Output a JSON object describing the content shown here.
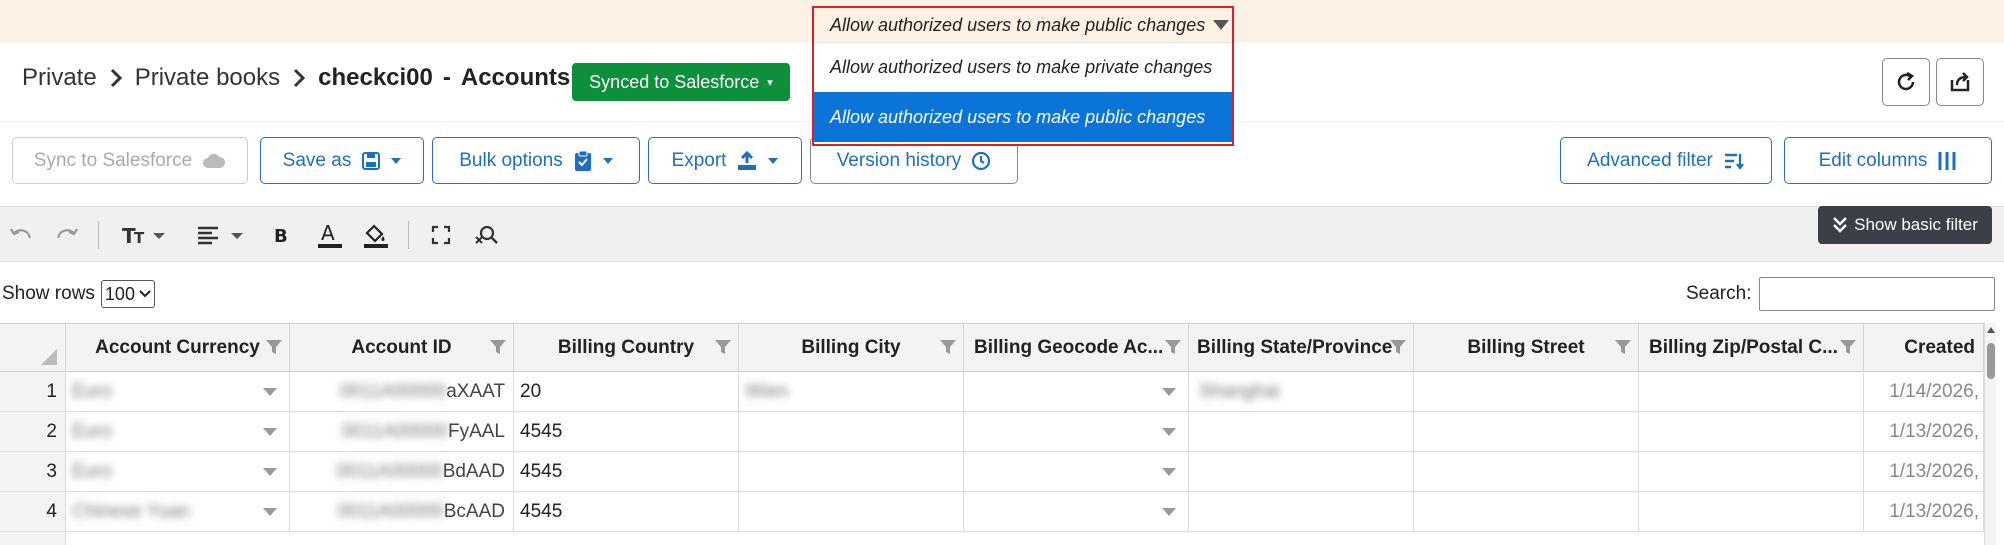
{
  "permission_dropdown": {
    "selected": "Allow authorized users to make public changes",
    "options": [
      "Allow authorized users to make private changes",
      "Allow authorized users to make public changes"
    ],
    "active_index": 1
  },
  "breadcrumb": {
    "root": "Private",
    "folder": "Private books",
    "book": "checkci00",
    "sheet": "Accounts"
  },
  "synced_button": {
    "label": "Synced to Salesforce",
    "color": "#0d8f3c"
  },
  "toolbar": {
    "sync": "Sync to Salesforce",
    "save_as": "Save as",
    "bulk_options": "Bulk options",
    "export": "Export",
    "version_history": "Version history",
    "advanced_filter": "Advanced filter",
    "edit_columns": "Edit columns"
  },
  "show_basic_filter": "Show basic filter",
  "rows_control": {
    "label": "Show rows",
    "value": "100"
  },
  "search": {
    "label": "Search:",
    "value": ""
  },
  "table": {
    "columns": [
      "Account Currency",
      "Account ID",
      "Billing Country",
      "Billing City",
      "Billing Geocode Ac...",
      "Billing State/Province",
      "Billing Street",
      "Billing Zip/Postal C...",
      "Created"
    ],
    "rows": [
      {
        "num": "1",
        "currency": "Euro",
        "id_prefix": "0011A00000",
        "id_suffix": "aXAAT",
        "country": "20",
        "city": "Wien",
        "state": "Shanghai",
        "created": "1/14/2026,"
      },
      {
        "num": "2",
        "currency": "Euro",
        "id_prefix": "0011A00000",
        "id_suffix": "FyAAL",
        "country": "4545",
        "city": "",
        "state": "",
        "created": "1/13/2026,"
      },
      {
        "num": "3",
        "currency": "Euro",
        "id_prefix": "0011A00000",
        "id_suffix": "BdAAD",
        "country": "4545",
        "city": "",
        "state": "",
        "created": "1/13/2026,"
      },
      {
        "num": "4",
        "currency": "Chinese Yuan",
        "id_prefix": "0011A00000",
        "id_suffix": "BcAAD",
        "country": "4545",
        "city": "",
        "state": "",
        "created": "1/13/2026,"
      }
    ]
  },
  "colors": {
    "accent": "#1e6fc0",
    "banner": "#fcf1e3",
    "highlight": "#0a74d9",
    "alert_border": "#d6212a"
  }
}
